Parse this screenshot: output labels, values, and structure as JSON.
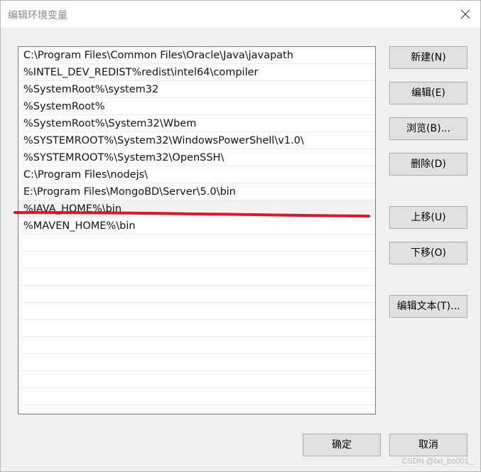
{
  "window": {
    "title": "编辑环境变量"
  },
  "list": {
    "items": [
      "C:\\Program Files\\Common Files\\Oracle\\Java\\javapath",
      "%INTEL_DEV_REDIST%redist\\intel64\\compiler",
      "%SystemRoot%\\system32",
      "%SystemRoot%",
      "%SystemRoot%\\System32\\Wbem",
      "%SYSTEMROOT%\\System32\\WindowsPowerShell\\v1.0\\",
      "%SYSTEMROOT%\\System32\\OpenSSH\\",
      "C:\\Program Files\\nodejs\\",
      "E:\\Program Files\\MongoBD\\Server\\5.0\\bin",
      "%JAVA_HOME%\\bin",
      "%MAVEN_HOME%\\bin"
    ],
    "selected_index": 9
  },
  "buttons": {
    "new": "新建(N)",
    "edit": "编辑(E)",
    "browse": "浏览(B)...",
    "delete": "删除(D)",
    "move_up": "上移(U)",
    "move_down": "下移(O)",
    "edit_text": "编辑文本(T)...",
    "ok": "确定",
    "cancel": "取消"
  },
  "watermark": "CSDN @bo_bo001_",
  "colors": {
    "annotation_line": "#d9182d"
  }
}
